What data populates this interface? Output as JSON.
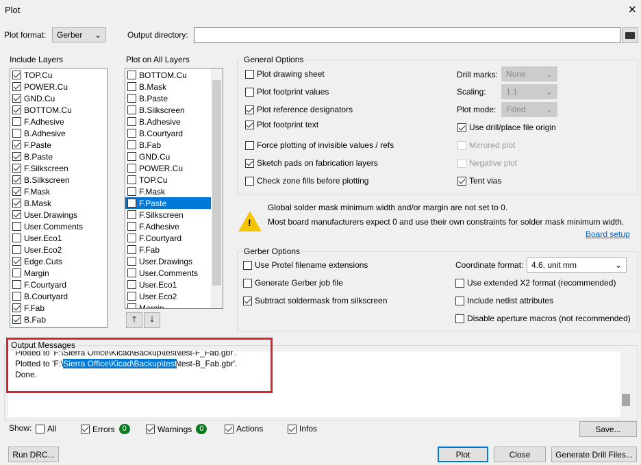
{
  "window": {
    "title": "Plot",
    "close": "✕"
  },
  "top": {
    "format_label": "Plot format:",
    "format_value": "Gerber",
    "outdir_label": "Output directory:",
    "outdir_value": ""
  },
  "include_layers": {
    "title": "Include Layers",
    "items": [
      {
        "label": "TOP.Cu",
        "checked": true
      },
      {
        "label": "POWER.Cu",
        "checked": true
      },
      {
        "label": "GND.Cu",
        "checked": true
      },
      {
        "label": "BOTTOM.Cu",
        "checked": true
      },
      {
        "label": "F.Adhesive",
        "checked": false
      },
      {
        "label": "B.Adhesive",
        "checked": false
      },
      {
        "label": "F.Paste",
        "checked": true
      },
      {
        "label": "B.Paste",
        "checked": true
      },
      {
        "label": "F.Silkscreen",
        "checked": true
      },
      {
        "label": "B.Silkscreen",
        "checked": true
      },
      {
        "label": "F.Mask",
        "checked": true
      },
      {
        "label": "B.Mask",
        "checked": true
      },
      {
        "label": "User.Drawings",
        "checked": true
      },
      {
        "label": "User.Comments",
        "checked": false
      },
      {
        "label": "User.Eco1",
        "checked": false
      },
      {
        "label": "User.Eco2",
        "checked": false
      },
      {
        "label": "Edge.Cuts",
        "checked": true
      },
      {
        "label": "Margin",
        "checked": false
      },
      {
        "label": "F.Courtyard",
        "checked": false
      },
      {
        "label": "B.Courtyard",
        "checked": false
      },
      {
        "label": "F.Fab",
        "checked": true
      },
      {
        "label": "B.Fab",
        "checked": true
      }
    ]
  },
  "all_layers": {
    "title": "Plot on All Layers",
    "selected": "F.Paste",
    "items": [
      "BOTTOM.Cu",
      "B.Mask",
      "B.Paste",
      "B.Silkscreen",
      "B.Adhesive",
      "B.Courtyard",
      "B.Fab",
      "GND.Cu",
      "POWER.Cu",
      "TOP.Cu",
      "F.Mask",
      "F.Paste",
      "F.Silkscreen",
      "F.Adhesive",
      "F.Courtyard",
      "F.Fab",
      "User.Drawings",
      "User.Comments",
      "User.Eco1",
      "User.Eco2",
      "Margin"
    ]
  },
  "general": {
    "title": "General Options",
    "options": [
      {
        "label": "Plot drawing sheet",
        "checked": false
      },
      {
        "label": "Plot footprint values",
        "checked": false
      },
      {
        "label": "Plot reference designators",
        "checked": true
      },
      {
        "label": "Plot footprint text",
        "checked": true
      },
      {
        "label": "Force plotting of invisible values / refs",
        "checked": false
      },
      {
        "label": "Sketch pads on fabrication layers",
        "checked": true
      },
      {
        "label": "Check zone fills before plotting",
        "checked": false
      }
    ],
    "drill_marks_label": "Drill marks:",
    "drill_marks": "None",
    "scaling_label": "Scaling:",
    "scaling": "1:1",
    "plot_mode_label": "Plot mode:",
    "plot_mode": "Filled",
    "right_options": [
      {
        "label": "Use drill/place file origin",
        "checked": true,
        "enabled": true
      },
      {
        "label": "Mirrored plot",
        "checked": false,
        "enabled": false
      },
      {
        "label": "Negative plot",
        "checked": false,
        "enabled": false
      },
      {
        "label": "Tent vias",
        "checked": true,
        "enabled": true
      }
    ]
  },
  "warning": {
    "line1": "Global solder mask minimum width and/or margin are not set to 0.",
    "line2": "Most board manufacturers expect 0 and use their own constraints for solder mask minimum width.",
    "link": "Board setup"
  },
  "gerber": {
    "title": "Gerber Options",
    "left": [
      {
        "label": "Use Protel filename extensions",
        "checked": false
      },
      {
        "label": "Generate Gerber job file",
        "checked": false
      },
      {
        "label": "Subtract soldermask from silkscreen",
        "checked": true
      }
    ],
    "coord_label": "Coordinate format:",
    "coord_value": "4.6, unit mm",
    "right": [
      {
        "label": "Use extended X2 format (recommended)",
        "checked": false
      },
      {
        "label": "Include netlist attributes",
        "checked": false
      },
      {
        "label": "Disable aperture macros (not recommended)",
        "checked": false
      }
    ]
  },
  "messages": {
    "title": "Output Messages",
    "line0": "Plotted to 'F:\\Sierra Office\\Kicad\\Backup\\test\\test-F_Fab.gbr'.",
    "line1_pre": "Plotted to 'F:\\",
    "line1_sel": "Sierra Office\\Kicad\\Backup\\test",
    "line1_post": "\\test-B_Fab.gbr'.",
    "line2": "Done."
  },
  "show": {
    "label": "Show:",
    "all": "All",
    "errors": "Errors",
    "errors_count": "0",
    "warnings": "Warnings",
    "warnings_count": "0",
    "actions": "Actions",
    "infos": "Infos",
    "save": "Save..."
  },
  "buttons": {
    "run_drc": "Run DRC...",
    "plot": "Plot",
    "close": "Close",
    "drill": "Generate Drill Files..."
  },
  "colors": {
    "selection": "#0078d7",
    "highlight_box": "#d9232d",
    "badge": "#0a7a1e"
  }
}
